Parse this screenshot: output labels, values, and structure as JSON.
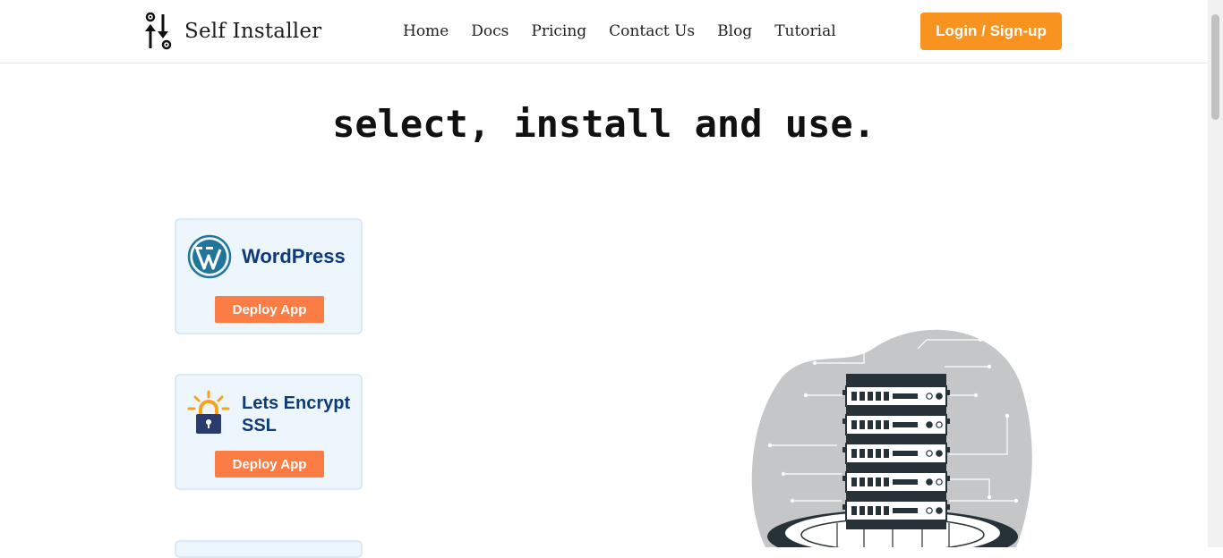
{
  "header": {
    "brand": "Self Installer",
    "logo_icon": "sliders-gear-icon",
    "nav": [
      {
        "label": "Home"
      },
      {
        "label": "Docs"
      },
      {
        "label": "Pricing"
      },
      {
        "label": "Contact Us"
      },
      {
        "label": "Blog"
      },
      {
        "label": "Tutorial"
      }
    ],
    "login_label": "Login / Sign-up"
  },
  "hero": {
    "title": "select, install and use."
  },
  "apps": [
    {
      "name": "WordPress",
      "icon": "wordpress-logo-icon",
      "button": "Deploy App"
    },
    {
      "name_line1": "Lets Encrypt",
      "name_line2": "SSL",
      "icon": "lets-encrypt-lock-icon",
      "button": "Deploy App"
    }
  ],
  "colors": {
    "accent": "#f7931e",
    "deploy": "#fb7c45",
    "card_bg": "#eef6fd",
    "card_title": "#0d3a7a"
  }
}
